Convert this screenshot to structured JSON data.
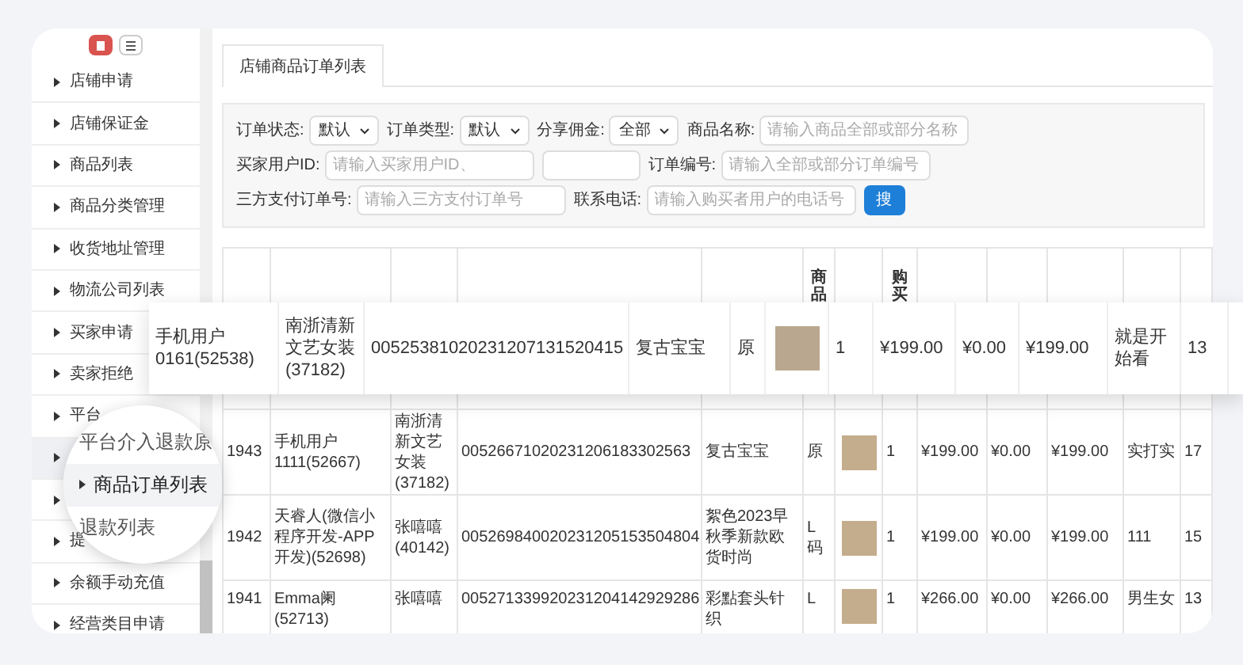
{
  "sidebar": {
    "items": [
      {
        "label": "店铺申请",
        "selected": false
      },
      {
        "label": "店铺保证金",
        "selected": false
      },
      {
        "label": "商品列表",
        "selected": false
      },
      {
        "label": "商品分类管理",
        "selected": false
      },
      {
        "label": "收货地址管理",
        "selected": false
      },
      {
        "label": "物流公司列表",
        "selected": false
      },
      {
        "label": "买家申请",
        "selected": false
      },
      {
        "label": "卖家拒绝",
        "selected": false
      },
      {
        "label": "平台",
        "selected": false
      },
      {
        "selected": true
      },
      {
        "selected": false
      },
      {
        "label": "提",
        "selected": false
      },
      {
        "label": "余额手动充值",
        "selected": false
      },
      {
        "label": "经营类目申请",
        "selected": false
      }
    ]
  },
  "tabs": [
    {
      "label": "店铺商品订单列表",
      "selected": true
    }
  ],
  "filters": {
    "row_1": [
      {
        "kind": "select",
        "label": "订单状态:",
        "value": "默认"
      },
      {
        "kind": "select",
        "label": "订单类型:",
        "value": "默认"
      },
      {
        "kind": "select",
        "label": "分享佣金:",
        "value": "全部"
      },
      {
        "kind": "input",
        "label": "商品名称:",
        "placeholder": "请输入商品全部或部分名称"
      },
      {
        "kind": "input",
        "label": "买家用户ID:",
        "placeholder": "请输入买家用户ID、"
      }
    ],
    "row_2": [
      {
        "kind": "input"
      },
      {
        "kind": "input",
        "label": "订单编号:",
        "placeholder": "请输入全部或部分订单编号"
      },
      {
        "kind": "input",
        "label": "三方支付订单号:",
        "placeholder": "请输入三方支付订单号"
      },
      {
        "kind": "input",
        "label": "联系电话:",
        "placeholder": "请输入购买者用户的电话号"
      }
    ],
    "search_button": "搜"
  },
  "table": {
    "columns": [
      {},
      {},
      {},
      {},
      {},
      {
        "label": "商品"
      },
      {},
      {
        "label": "购买"
      },
      {},
      {},
      {},
      {},
      {}
    ],
    "rows": [
      {
        "cells": [
          {},
          {},
          {},
          {},
          {},
          {},
          {},
          {},
          {},
          {},
          {},
          {},
          {}
        ]
      },
      {
        "cells": [
          {
            "text": "1943"
          },
          {
            "text": "手机用户 1111(52667)"
          },
          {
            "text": "南浙清新文艺女装(37182)"
          },
          {
            "text": "00526671020231206183302563"
          },
          {
            "text": "复古宝宝"
          },
          {
            "text": "原"
          },
          {
            "kind": "photo"
          },
          {
            "text": "1"
          },
          {
            "text": "¥199.00"
          },
          {
            "text": "¥0.00"
          },
          {
            "text": "¥199.00"
          },
          {
            "text": "实打实"
          },
          {
            "text": "17"
          }
        ]
      },
      {
        "cells": [
          {
            "text": "1942"
          },
          {
            "text": "天睿人(微信小程序开发-APP开发)(52698)"
          },
          {
            "text": "张嘻嘻(40142)"
          },
          {
            "text": "005269840020231205153504804"
          },
          {
            "text": "絮色2023早秋季新款欧货时尚"
          },
          {
            "text": "L码"
          },
          {
            "kind": "photo"
          },
          {
            "text": "1"
          },
          {
            "text": "¥199.00"
          },
          {
            "text": "¥0.00"
          },
          {
            "text": "¥199.00"
          },
          {
            "text": "111"
          },
          {
            "text": "15"
          }
        ]
      },
      {
        "cells": [
          {
            "text": "1941"
          },
          {
            "text": "Emma阑(52713)"
          },
          {
            "text": "张嘻嘻"
          },
          {
            "text": "005271339920231204142929286"
          },
          {
            "text": "彩點套头针织"
          },
          {
            "text": "L"
          },
          {
            "kind": "photo"
          },
          {
            "text": "1"
          },
          {
            "text": "¥266.00"
          },
          {
            "text": "¥0.00"
          },
          {
            "text": "¥266.00"
          },
          {
            "text": "男生女"
          },
          {
            "text": "13"
          }
        ]
      }
    ]
  },
  "magnified_row": {
    "cells": [
      {
        "text": "手机用户 0161(52538)"
      },
      {
        "text": "南浙清新文艺女装(37182)"
      },
      {
        "text": "00525381020231207131520415"
      },
      {
        "text": "复古宝宝"
      },
      {
        "text": "原"
      },
      {
        "kind": "photo"
      },
      {
        "text": "1"
      },
      {
        "text": "¥199.00"
      },
      {
        "text": "¥0.00"
      },
      {
        "text": "¥199.00"
      },
      {
        "text": "就是开始看"
      },
      {
        "text": "13"
      }
    ]
  },
  "magnifier": {
    "items": [
      {
        "label": "平台介入退款原",
        "selected": false
      },
      {
        "label": "商品订单列表",
        "selected": true
      },
      {
        "label": "退款列表",
        "selected": false
      }
    ]
  }
}
